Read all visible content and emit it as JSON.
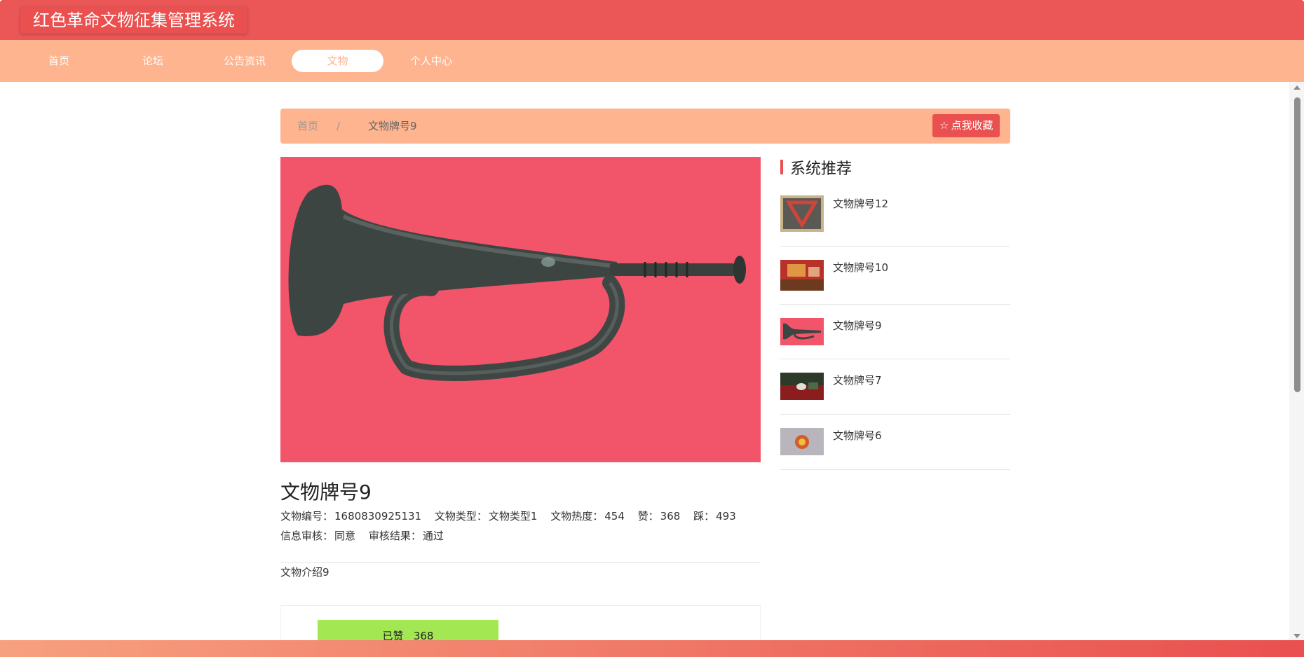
{
  "app": {
    "title": "红色革命文物征集管理系统"
  },
  "nav": {
    "items": [
      {
        "label": "首页",
        "active": false
      },
      {
        "label": "论坛",
        "active": false
      },
      {
        "label": "公告资讯",
        "active": false
      },
      {
        "label": "文物",
        "active": true
      },
      {
        "label": "个人中心",
        "active": false
      }
    ]
  },
  "breadcrumb": {
    "home": "首页",
    "separator": "/",
    "current": "文物牌号9"
  },
  "favorite": {
    "icon": "star-outline-icon",
    "label": "点我收藏"
  },
  "detail": {
    "image_icon": "bugle-photo",
    "title": "文物牌号9",
    "fields_row1": [
      {
        "label": "文物编号：",
        "value": "1680830925131"
      },
      {
        "label": "文物类型：",
        "value": "文物类型1"
      },
      {
        "label": "文物热度：",
        "value": "454"
      },
      {
        "label": "赞：",
        "value": "368"
      },
      {
        "label": "踩：",
        "value": "493"
      }
    ],
    "fields_row2": [
      {
        "label": "信息审核：",
        "value": "同意"
      },
      {
        "label": "审核结果：",
        "value": "通过"
      }
    ],
    "description": "文物介绍9"
  },
  "like": {
    "label": "已赞",
    "count": "368"
  },
  "recommend": {
    "title": "系统推荐",
    "items": [
      {
        "label": "文物牌号12",
        "thumb": "red-scarf-photo"
      },
      {
        "label": "文物牌号10",
        "thumb": "flag-photo"
      },
      {
        "label": "文物牌号9",
        "thumb": "bugle-photo"
      },
      {
        "label": "文物牌号7",
        "thumb": "medal-box-photo"
      },
      {
        "label": "文物牌号6",
        "thumb": "badge-photo"
      }
    ]
  },
  "colors": {
    "header": "#eb5757",
    "nav": "#fdb48f",
    "accent": "#e9504f",
    "like_button": "#a3e852"
  }
}
